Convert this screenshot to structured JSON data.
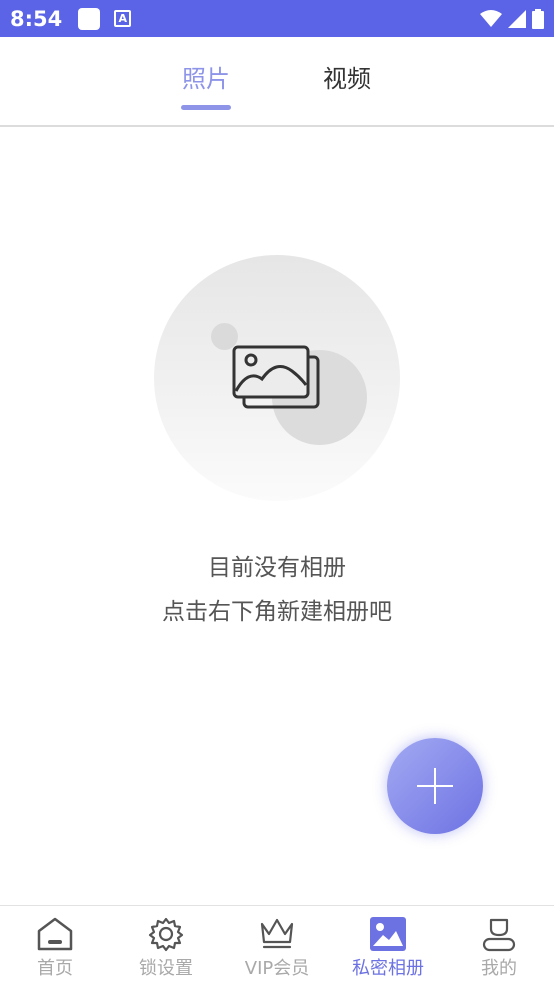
{
  "status_bar": {
    "time": "8:54",
    "a_icon_letter": "A"
  },
  "tabs": [
    {
      "label": "照片",
      "active": true
    },
    {
      "label": "视频",
      "active": false
    }
  ],
  "empty_state": {
    "line1": "目前没有相册",
    "line2": "点击右下角新建相册吧"
  },
  "fab": {
    "icon": "plus-icon"
  },
  "bottom_nav": [
    {
      "label": "首页",
      "icon": "home-icon",
      "active": false
    },
    {
      "label": "锁设置",
      "icon": "gear-icon",
      "active": false
    },
    {
      "label": "VIP会员",
      "icon": "crown-icon",
      "active": false
    },
    {
      "label": "私密相册",
      "icon": "image-icon",
      "active": true
    },
    {
      "label": "我的",
      "icon": "person-icon",
      "active": false
    }
  ],
  "colors": {
    "status_bar": "#5b63e6",
    "accent": "#6d72e3",
    "tab_active": "#8e95e8",
    "inactive": "#a9a9a9"
  }
}
